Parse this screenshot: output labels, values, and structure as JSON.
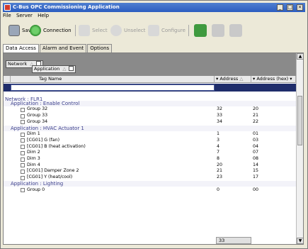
{
  "window": {
    "title": "C-Bus OPC Commissioning Application",
    "controls": [
      "_",
      "□",
      "×"
    ]
  },
  "menu": [
    "File",
    "Server",
    "Help"
  ],
  "toolbar": {
    "save": "Save",
    "connection": "Connection",
    "select": "Select",
    "unselect": "Unselect",
    "configure": "Configure"
  },
  "tabs": [
    "Data Access",
    "Alarm and Event",
    "Options"
  ],
  "grouping": {
    "network": "Network",
    "application": "Application"
  },
  "columns": {
    "tag_name": "Tag Name",
    "address": "Address",
    "address_hex": "Address (hex)"
  },
  "rows": [
    {
      "type": "net",
      "name": "Network : FLR1"
    },
    {
      "type": "app",
      "name": "Application : Enable Control"
    },
    {
      "type": "item",
      "name": "Group 32",
      "address": "32",
      "hex": "20"
    },
    {
      "type": "item",
      "name": "Group 33",
      "address": "33",
      "hex": "21"
    },
    {
      "type": "item",
      "name": "Group 34",
      "address": "34",
      "hex": "22"
    },
    {
      "type": "app",
      "name": "Application : HVAC Actuator 1"
    },
    {
      "type": "item",
      "name": "Dim 1",
      "address": "1",
      "hex": "01"
    },
    {
      "type": "item",
      "name": "[CG01] G (fan)",
      "address": "3",
      "hex": "03"
    },
    {
      "type": "item",
      "name": "[CG01] B (heat activation)",
      "address": "4",
      "hex": "04"
    },
    {
      "type": "item",
      "name": "Dim 2",
      "address": "7",
      "hex": "07"
    },
    {
      "type": "item",
      "name": "Dim 3",
      "address": "8",
      "hex": "08"
    },
    {
      "type": "item",
      "name": "Dim 4",
      "address": "20",
      "hex": "14"
    },
    {
      "type": "item",
      "name": "[CG01] Damper Zone 2",
      "address": "21",
      "hex": "15"
    },
    {
      "type": "item",
      "name": "[CG01] Y (heat/cool)",
      "address": "23",
      "hex": "17"
    },
    {
      "type": "app",
      "name": "Application : Lighting"
    },
    {
      "type": "item",
      "name": "Group 0",
      "address": "0",
      "hex": "00"
    }
  ],
  "footer_count": "33",
  "colors": {
    "titlebar": "#2b5cc0",
    "filter_row": "#1f2d6b",
    "group_text": "#3b3f8c"
  }
}
